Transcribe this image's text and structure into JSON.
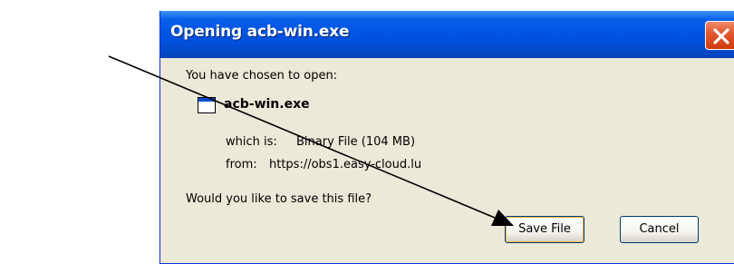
{
  "dialog": {
    "title": "Opening acb-win.exe",
    "prompt": "You have chosen to open:",
    "file": {
      "name": "acb-win.exe",
      "which_label": "which is:",
      "which_value": "Binary File (104 MB)",
      "from_label": "from:",
      "from_value": "https://obs1.easy-cloud.lu",
      "icon": "application-window-icon"
    },
    "question": "Would you like to save this file?",
    "buttons": {
      "save": "Save File",
      "cancel": "Cancel"
    },
    "close_icon": "close-x-icon"
  },
  "annotation": {
    "icon": "pointer-arrow-icon",
    "color": "#000000"
  },
  "colors": {
    "titlebar": "#0054e3",
    "close_button": "#e45a30",
    "dialog_background": "#ece9d8"
  }
}
